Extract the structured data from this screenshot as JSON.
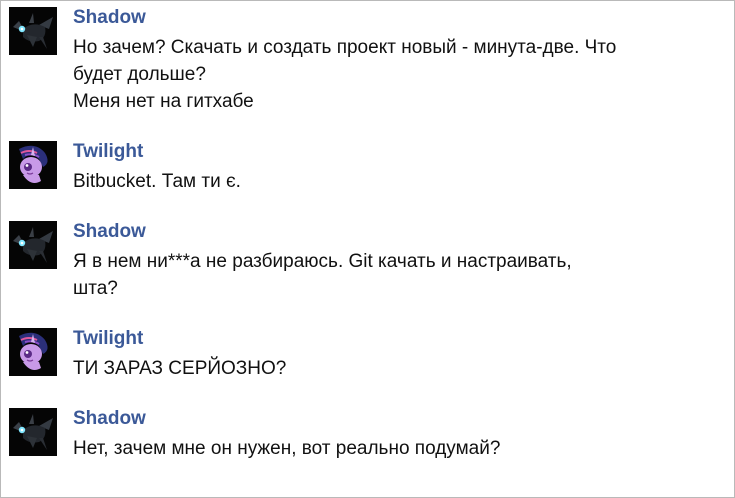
{
  "messages": [
    {
      "author": "Shadow",
      "avatar_icon": "changeling-avatar-icon",
      "lines": [
        "Но зачем? Скачать и создать проект новый - минута-две. Что",
        "будет дольше?",
        "Меня нет на гитхабе"
      ]
    },
    {
      "author": "Twilight",
      "avatar_icon": "twilight-pony-avatar-icon",
      "lines": [
        "Bitbucket. Там ти є."
      ]
    },
    {
      "author": "Shadow",
      "avatar_icon": "changeling-avatar-icon",
      "lines": [
        "Я в нем ни***а не разбираюсь. Git качать и настраивать,",
        "шта?"
      ]
    },
    {
      "author": "Twilight",
      "avatar_icon": "twilight-pony-avatar-icon",
      "lines": [
        "ТИ ЗАРАЗ СЕРЙОЗНО?"
      ]
    },
    {
      "author": "Shadow",
      "avatar_icon": "changeling-avatar-icon",
      "lines": [
        "Нет, зачем мне он нужен, вот реально подумай?"
      ]
    }
  ],
  "colors": {
    "author_name": "#3b5998",
    "message_text": "#111111",
    "avatar_background": "#050505",
    "frame_border": "#b9b9b9"
  }
}
